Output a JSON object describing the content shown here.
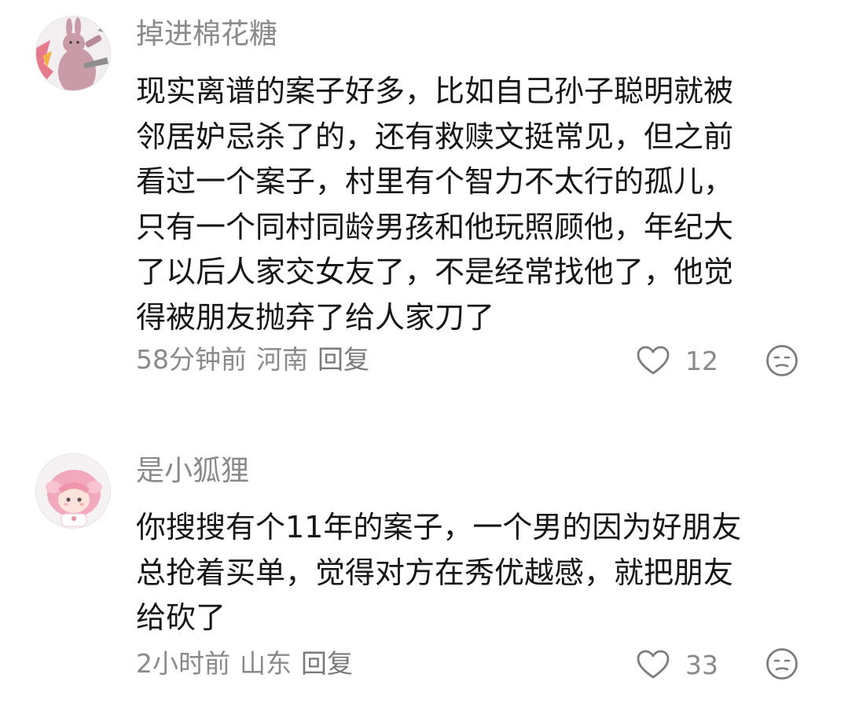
{
  "comments": [
    {
      "username": "掉进棉花糖",
      "avatar_icon": "rabbit-avatar-icon",
      "lines": [
        "现实离谱的案子好多，比如自己孙子聪明就被",
        "邻居妒忌杀了的，还有救赎文挺常见，但之前",
        "看过一个案子，村里有个智力不太行的孤儿，",
        "只有一个同村同龄男孩和他玩照顾他，年纪大",
        "了以后人家交女友了，不是经常找他了，他觉",
        "得被朋友抛弃了给人家刀了"
      ],
      "time": "58分钟前",
      "location": "河南",
      "reply_label": "回复",
      "like_count": "12",
      "like_icon": "heart-icon",
      "emoji_icon": "meh-face-icon"
    },
    {
      "username": "是小狐狸",
      "avatar_icon": "pink-hair-girl-avatar-icon",
      "lines": [
        "你搜搜有个11年的案子，一个男的因为好朋友",
        "总抢着买单，觉得对方在秀优越感，就把朋友",
        "给砍了"
      ],
      "time": "2小时前",
      "location": "山东",
      "reply_label": "回复",
      "like_count": "33",
      "like_icon": "heart-icon",
      "emoji_icon": "meh-face-icon"
    }
  ],
  "colors": {
    "text_primary": "#161616",
    "text_secondary": "#8a8a8a",
    "icon_gray": "#7d7d7d"
  }
}
